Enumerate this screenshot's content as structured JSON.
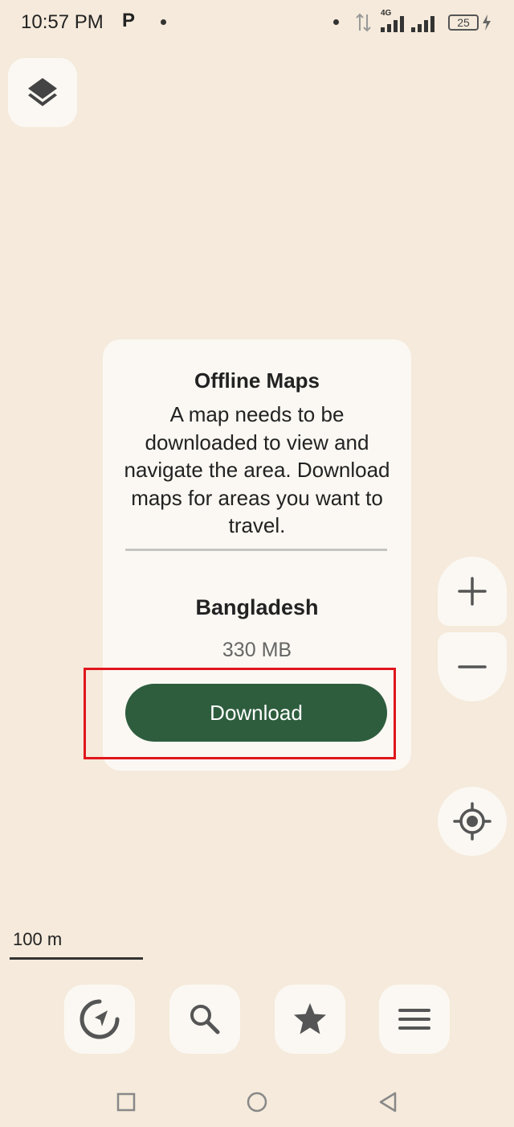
{
  "status_bar": {
    "time": "10:57 PM",
    "app_indicator": "P",
    "network": "4G",
    "battery": "25"
  },
  "dialog": {
    "title": "Offline Maps",
    "message": "A map needs to be downloaded to view and navigate the area. Download maps for areas you want to travel.",
    "region_name": "Bangladesh",
    "region_size": "330 MB",
    "download_label": "Download"
  },
  "map": {
    "scale_label": "100 m"
  },
  "icons": {
    "layers": "layers-icon",
    "zoom_in": "plus-icon",
    "zoom_out": "minus-icon",
    "location": "my-location-icon",
    "route": "navigation-icon",
    "search": "search-icon",
    "bookmarks": "star-icon",
    "menu": "menu-icon"
  },
  "colors": {
    "map_background": "#f5eadb",
    "primary_button": "#2e5d3e",
    "highlight": "#e0161c"
  }
}
